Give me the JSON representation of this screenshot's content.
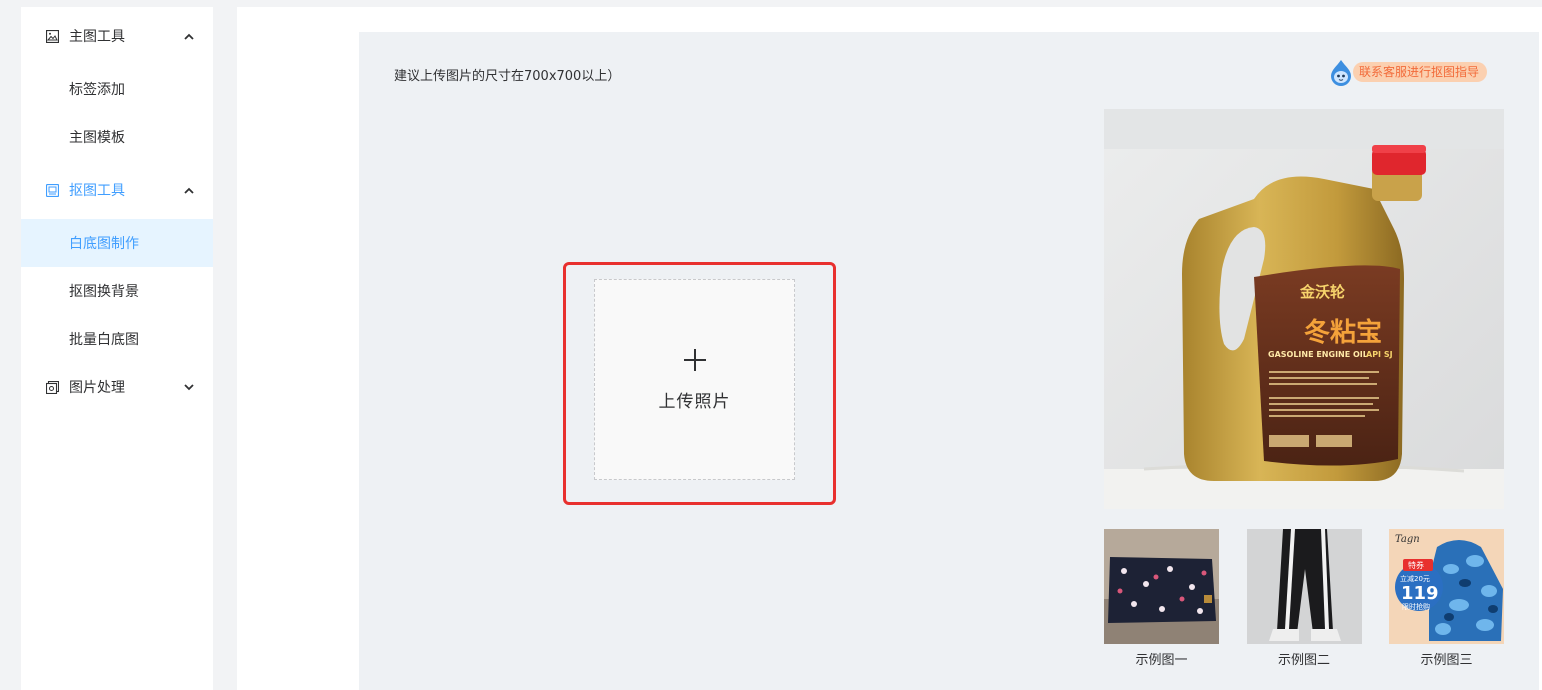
{
  "sidebar": {
    "groups": [
      {
        "label": "主图工具",
        "icon": "image-icon",
        "expanded": true,
        "items": [
          {
            "label": "标签添加"
          },
          {
            "label": "主图模板"
          }
        ]
      },
      {
        "label": "抠图工具",
        "icon": "cutout-icon",
        "expanded": true,
        "active": true,
        "items": [
          {
            "label": "白底图制作",
            "selected": true
          },
          {
            "label": "抠图换背景"
          },
          {
            "label": "批量白底图"
          }
        ]
      },
      {
        "label": "图片处理",
        "icon": "image-process-icon",
        "expanded": false,
        "items": []
      }
    ],
    "bottom_icon": "menu-collapse-icon"
  },
  "main": {
    "hint": "建议上传图片的尺寸在700x700以上）",
    "service_button": {
      "label": "联系客服进行抠图指导",
      "icon": "mascot-icon"
    },
    "upload": {
      "label": "上传照片",
      "icon": "plus-icon"
    },
    "preview": {
      "product_brand": "金沃轮",
      "product_name": "冬粘宝",
      "product_sub": "GASOLINE ENGINE OIL",
      "product_grade": "API SJ"
    },
    "examples": [
      {
        "caption": "示例图一"
      },
      {
        "caption": "示例图二"
      },
      {
        "caption": "示例图三",
        "badge_top": "特券",
        "badge_mid": "立减20元",
        "badge_price": "119",
        "badge_bottom": "限时抢购",
        "brand": "Tagn"
      }
    ]
  },
  "colors": {
    "accent": "#409eff",
    "highlight": "#e8302e",
    "panel": "#eef1f4"
  }
}
